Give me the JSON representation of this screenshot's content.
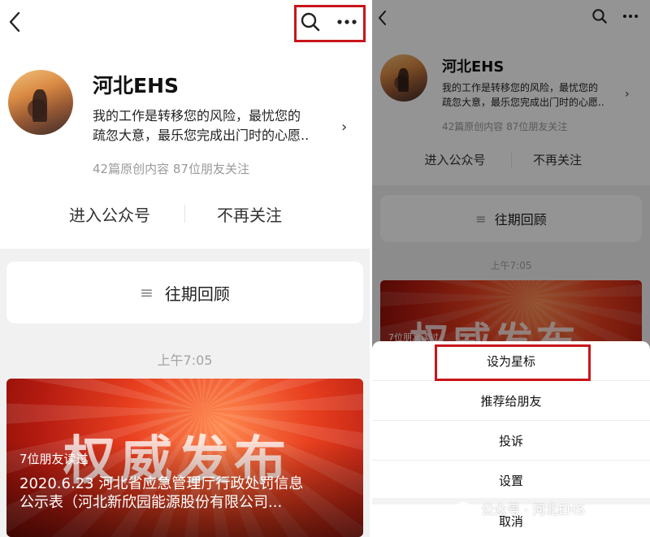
{
  "account": {
    "name": "河北EHS",
    "description_line1": "我的工作是转移您的风险，最忧您的",
    "description_line2": "疏忽大意，最乐您完成出门时的心愿..",
    "stats": "42篇原创内容   87位朋友关注"
  },
  "actions": {
    "enter": "进入公众号",
    "unfollow": "不再关注"
  },
  "history_label": "往期回顾",
  "post_time": "上午7:05",
  "article": {
    "banner": "权威发布",
    "friends_read": "7位朋友读过",
    "title_line1": "2020.6.23 河北省应急管理厅行政处罚信息",
    "title_line2": "公示表（河北新欣园能源股份有限公司..."
  },
  "menu": {
    "items": [
      {
        "label": "设为星标"
      },
      {
        "label": "推荐给朋友"
      },
      {
        "label": "投诉"
      },
      {
        "label": "设置"
      }
    ],
    "cancel": "取消"
  },
  "watermark": {
    "text": "公众号 · 河北EHS"
  },
  "icons": {
    "back": "chevron-left-icon",
    "search": "search-icon",
    "more": "more-dots-icon",
    "list": "list-icon",
    "chevron": "chevron-right-icon"
  },
  "colors": {
    "highlight": "#c8151b",
    "article_red": "#e83f1f",
    "muted_text": "#9a9a9a",
    "background_gray": "#f1f1f1"
  }
}
